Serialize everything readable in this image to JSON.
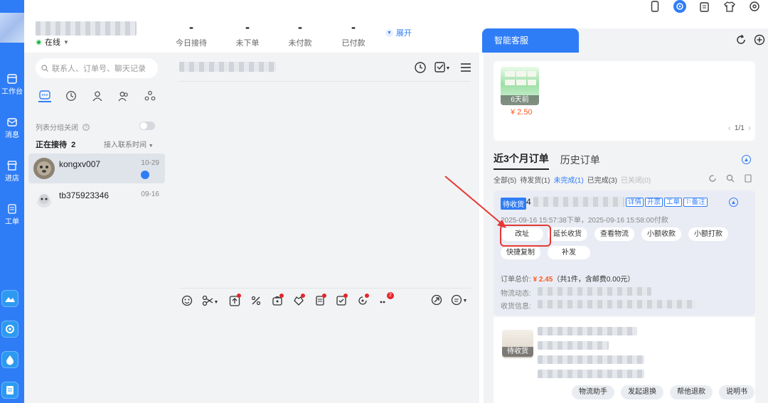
{
  "rail": {
    "items": [
      {
        "label": "工作台",
        "icon": "workbench-icon"
      },
      {
        "label": "消息",
        "icon": "message-icon"
      },
      {
        "label": "进店",
        "icon": "store-icon"
      },
      {
        "label": "工单",
        "icon": "ticket-icon"
      }
    ]
  },
  "header": {
    "status": "在线",
    "stats": [
      {
        "value": "-",
        "label": "今日接待"
      },
      {
        "value": "-",
        "label": "未下单"
      },
      {
        "value": "-",
        "label": "未付款"
      },
      {
        "value": "-",
        "label": "已付款"
      }
    ],
    "expand_label": "展开",
    "top_icons": [
      "phone-icon",
      "service-icon",
      "edit-icon",
      "shirt-icon",
      "settings-icon"
    ]
  },
  "contacts": {
    "search_placeholder": "联系人、订单号、聊天记录",
    "group_toggle_label": "列表分组关闭",
    "receiving_label": "正在接待",
    "receiving_count": "2",
    "sort_label": "接入联系时间",
    "list": [
      {
        "name": "kongxv007",
        "date": "10-29"
      },
      {
        "name": "tb375923346",
        "date": "09-16"
      }
    ]
  },
  "chat": {
    "toolbar_badge": "2"
  },
  "assistant": {
    "tab_label": "智能客服",
    "product": {
      "tag": "6天前",
      "price": "¥ 2.50"
    },
    "pager": "1/1",
    "order_tabs": [
      "近3个月订单",
      "历史订单"
    ],
    "status_filters": [
      {
        "label": "全部(5)",
        "state": "normal"
      },
      {
        "label": "待发货(1)",
        "state": "normal"
      },
      {
        "label": "未完成(1)",
        "state": "active"
      },
      {
        "label": "已完成(3)",
        "state": "normal"
      },
      {
        "label": "已关闭(0)",
        "state": "dim"
      }
    ],
    "order": {
      "status": "待收货",
      "id_prefix": "4",
      "links": [
        "详情",
        "开票",
        "工单",
        "备注"
      ],
      "time": "2025-09-16 15:57:38下单，2025-09-16 15:58:00付款",
      "actions": [
        "改址",
        "延长收货",
        "查看物流",
        "小额收款",
        "小额打款",
        "快捷复制",
        "补发"
      ],
      "total_label": "订单总价:",
      "total_price": "¥ 2.45",
      "total_note": "（共1件，含邮费0.00元）",
      "logistics_label": "物流动态:",
      "address_label": "收货信息:"
    },
    "item": {
      "tag": "待收货"
    },
    "bottom_actions": [
      "物流助手",
      "发起退换",
      "帮他退款",
      "说明书"
    ]
  },
  "colors": {
    "brand": "#2f7df6",
    "price": "#ff5a1f",
    "annotation": "#e53935"
  }
}
